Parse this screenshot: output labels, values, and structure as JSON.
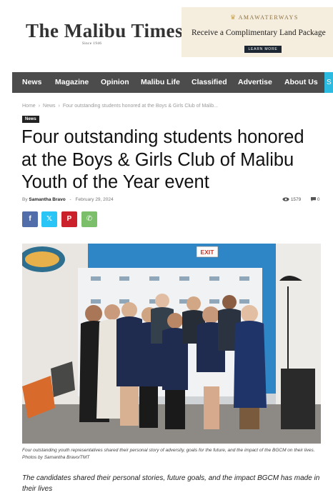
{
  "header": {
    "logo_text": "The Malibu Times",
    "logo_sub": "Since 1946"
  },
  "ad": {
    "brand": "AMAWATERWAYS",
    "headline": "Receive a Complimentary Land Package",
    "button": "LEARN MORE",
    "bg_color": "#f5eedf"
  },
  "nav": {
    "items": [
      {
        "label": "News"
      },
      {
        "label": "Magazine"
      },
      {
        "label": "Opinion"
      },
      {
        "label": "Malibu Life"
      },
      {
        "label": "Classified"
      },
      {
        "label": "Advertise"
      },
      {
        "label": "About Us"
      }
    ],
    "search_glyph": "S",
    "bg_color": "#4c4c4c",
    "accent_color": "#2bbbe0"
  },
  "breadcrumb": {
    "items": [
      "Home",
      "News",
      "Four outstanding students honored at the Boys & Girls Club of Malib..."
    ],
    "separator": "›"
  },
  "article": {
    "category": "News",
    "title": "Four outstanding students honored at the Boys & Girls Club of Malibu Youth of the Year event",
    "author_prefix": "By",
    "author": "Samantha Bravo",
    "date": "February 29, 2024",
    "views": "1579",
    "comments": "0",
    "photo_alt_icon": "group-photo",
    "caption": "Four outstanding youth representatives shared their personal story of adversity, goals for the future, and the impact of the BGCM on their lives. Photos by Samantha Bravo/TMT",
    "lead": "The candidates shared their personal stories, future goals, and the impact BGCM has made in their lives"
  },
  "share": [
    {
      "icon": "facebook-icon",
      "glyph": "f",
      "color": "#516eab"
    },
    {
      "icon": "twitter-x-icon",
      "glyph": "𝕏",
      "color": "#29c5f6"
    },
    {
      "icon": "pinterest-icon",
      "glyph": "P",
      "color": "#ca212a"
    },
    {
      "icon": "whatsapp-icon",
      "glyph": "✆",
      "color": "#7bbf6a"
    }
  ],
  "exit_sign": "EXIT"
}
